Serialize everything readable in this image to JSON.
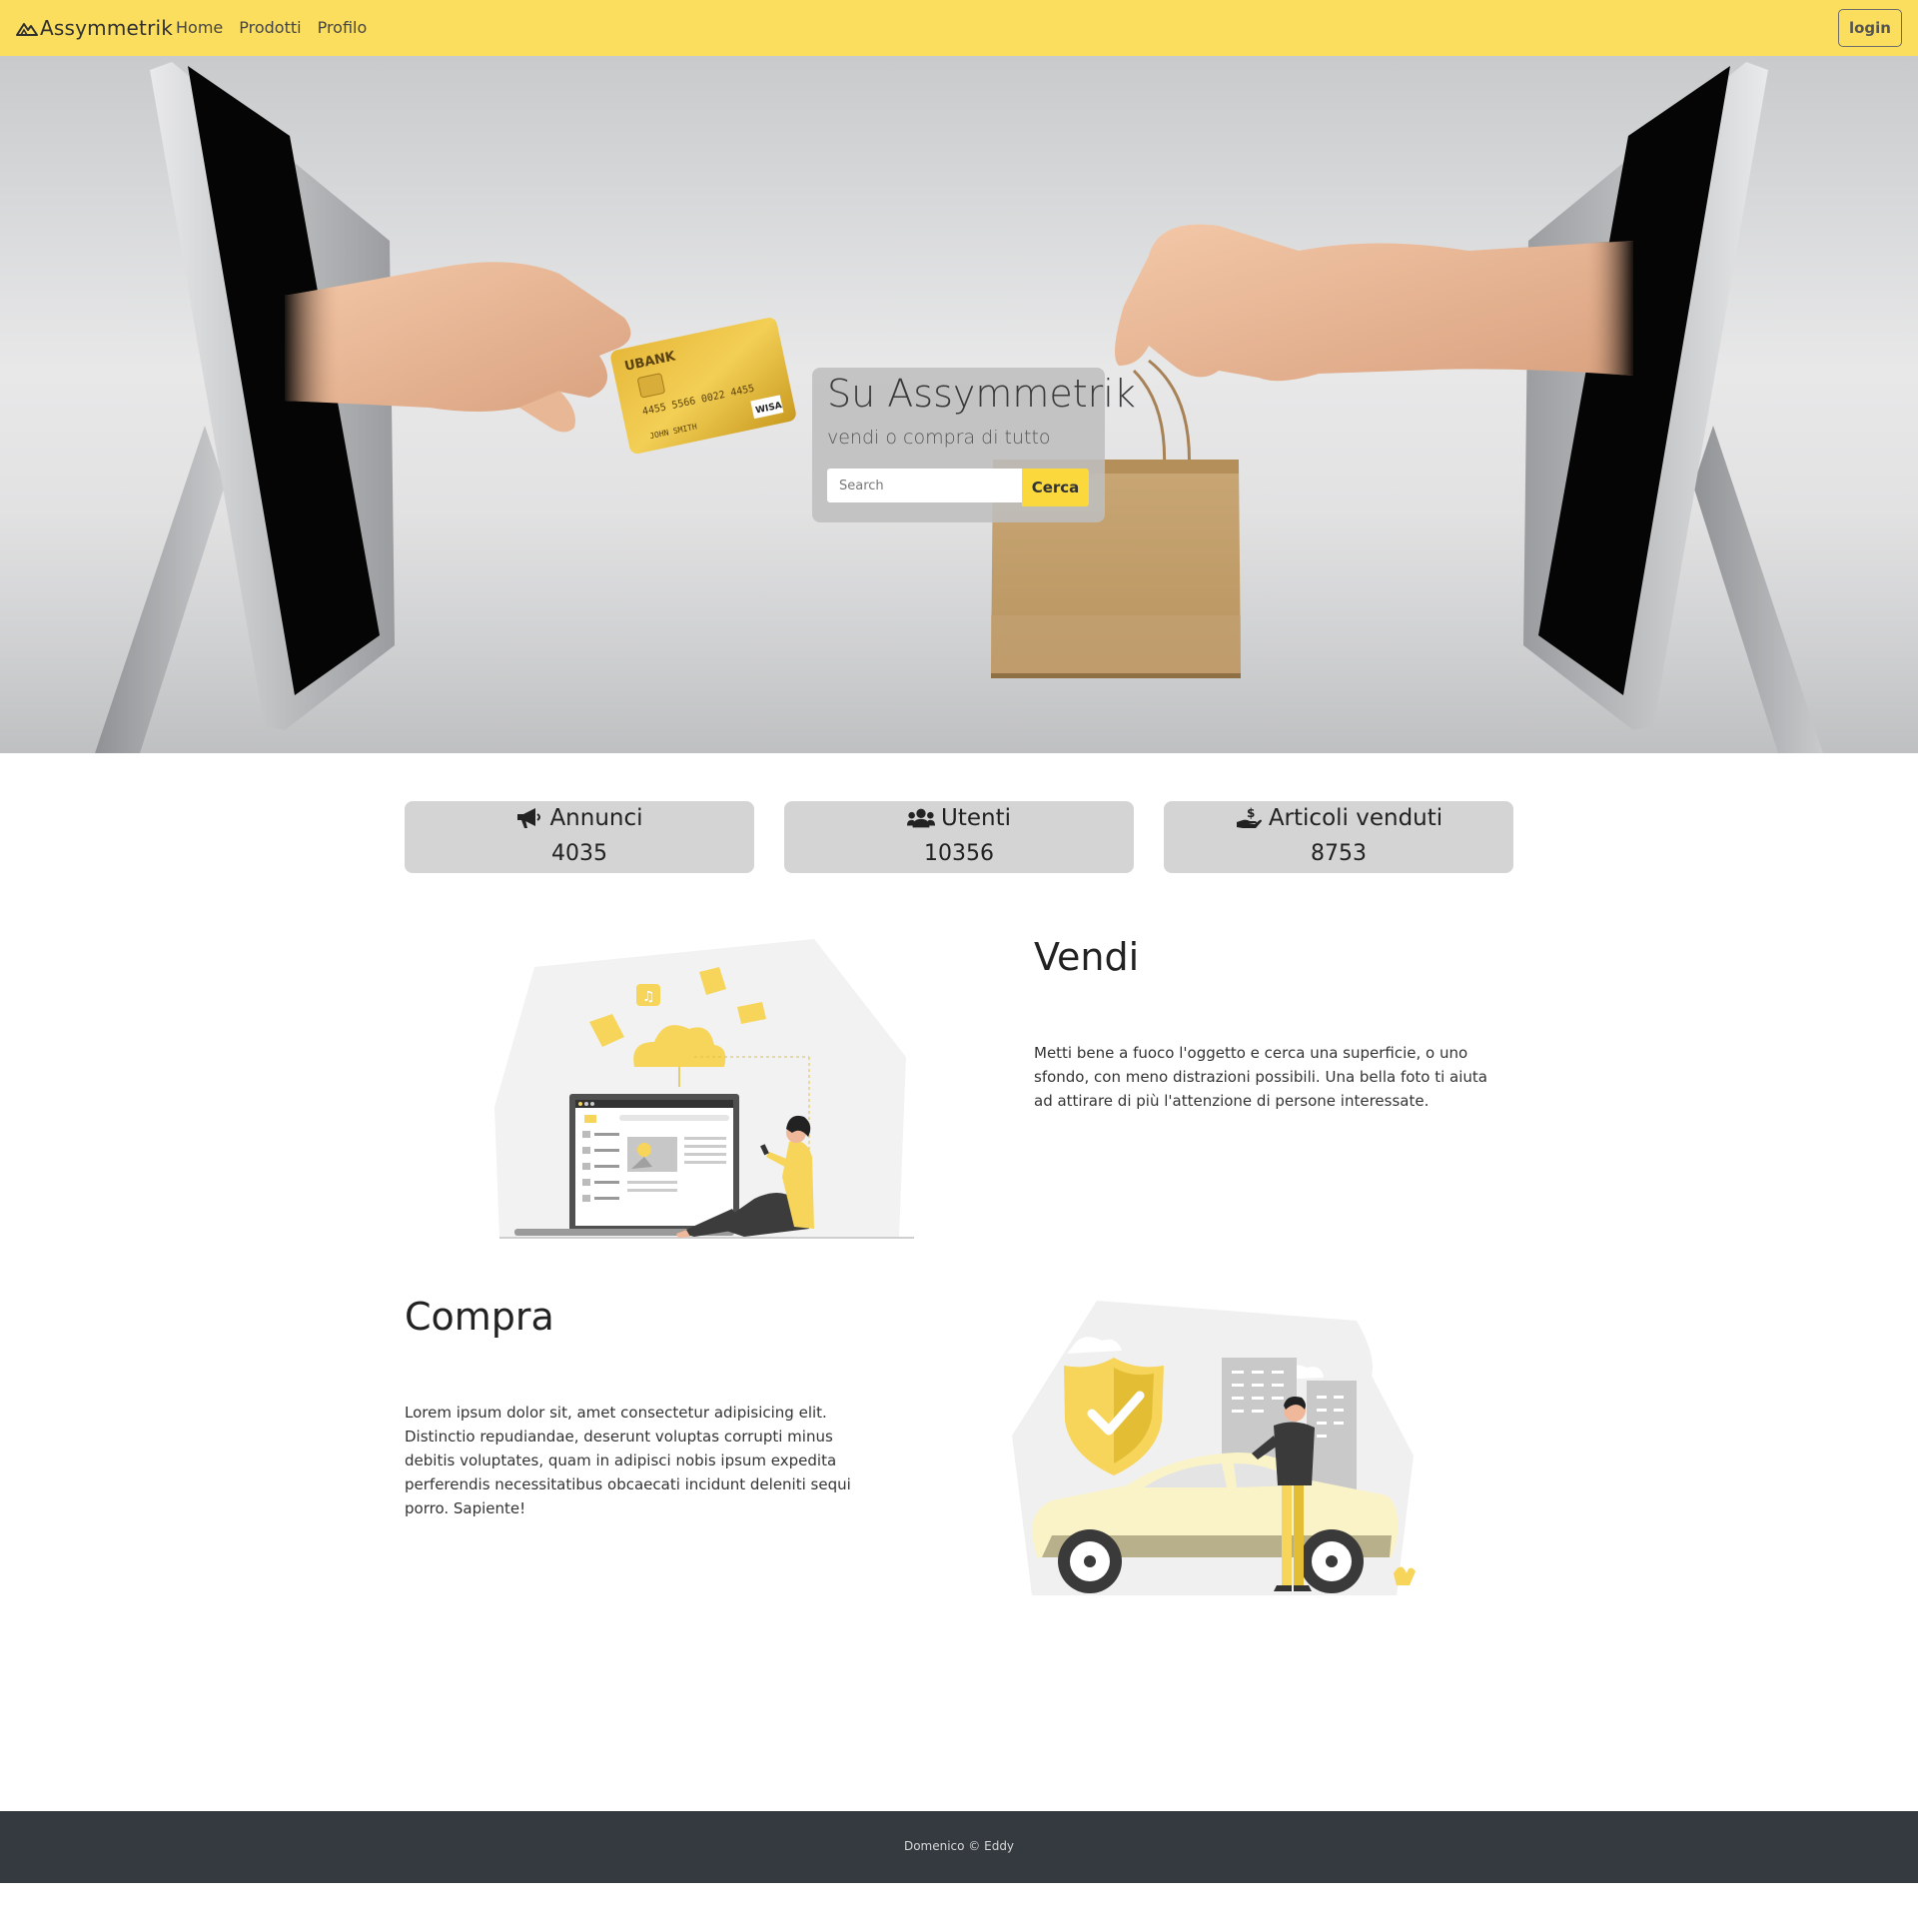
{
  "navbar": {
    "brand": "Assymmetrik",
    "links": [
      "Home",
      "Prodotti",
      "Profilo"
    ],
    "login_label": "login",
    "background_color": "#fbde5e"
  },
  "hero": {
    "title": "Su Assymmetrik",
    "subtitle": "vendi o compra di tutto",
    "search": {
      "placeholder": "Search",
      "button_label": "Cerca"
    },
    "card_text": {
      "bank": "UBANK",
      "number": "4455 5566 0022 4455",
      "holder": "JOHN SMITH",
      "network": "WISA"
    }
  },
  "stats": [
    {
      "icon": "megaphone-icon",
      "label": "Annunci",
      "value": "4035"
    },
    {
      "icon": "users-icon",
      "label": "Utenti",
      "value": "10356"
    },
    {
      "icon": "hand-holding-dollar-icon",
      "label": "Articoli venduti",
      "value": "8753"
    }
  ],
  "sections": {
    "vendi": {
      "title": "Vendi",
      "text": "Metti bene a fuoco l'oggetto e cerca una superficie, o uno sfondo, con meno distrazioni possibili. Una bella foto ti aiuta ad attirare di più l'attenzione di persone interessate.",
      "illustration": "person-with-laptop-cloud-illustration"
    },
    "compra": {
      "title": "Compra",
      "text": "Lorem ipsum dolor sit, amet consectetur adipisicing elit. Distinctio repudiandae, deserunt voluptas corrupti minus debitis voluptates, quam in adipisci nobis ipsum expedita perferendis necessitatibus obcaecati incidunt deleniti sequi porro. Sapiente!",
      "illustration": "person-with-car-shield-illustration"
    }
  },
  "footer": {
    "text": "Domenico © Eddy"
  },
  "colors": {
    "accent": "#fbd93c",
    "footer": "#343a40",
    "stat_bg": "#d4d4d4"
  }
}
